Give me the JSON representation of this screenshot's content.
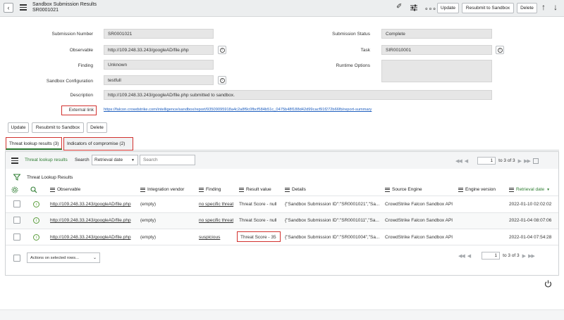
{
  "header": {
    "back_icon": "chevron-left-icon",
    "menu_icon": "hamburger-icon",
    "title": "Sandbox Submission Results",
    "record_id": "SR0001021",
    "attach_icon": "paperclip-icon",
    "settings_icon": "sliders-icon",
    "more_icon": "ellipsis-icon",
    "update_label": "Update",
    "resubmit_label": "Resubmit to Sandbox",
    "delete_label": "Delete",
    "up_icon": "arrow-up-icon",
    "down_icon": "arrow-down-icon"
  },
  "form": {
    "submission_number_label": "Submission Number",
    "submission_number": "SR0001021",
    "observable_label": "Observable",
    "observable": "http://109.248.33.243/googleAD/file.php",
    "finding_label": "Finding",
    "finding": "Unknown",
    "sandbox_config_label": "Sandbox Configuration",
    "sandbox_config": "testfull",
    "description_label": "Description",
    "description": "http://109.248.33.243/googleAD/file.php submitted to sandbox.",
    "external_link_label": "External link",
    "external_link": "https://falcon.crowdstrike.com/intelligence/sandbox/report/93509095918a4c2a8f9c0fbcf584b51c_0475b48f188d42d99cacf91f272b66fb/report-summary",
    "submission_status_label": "Submission Status",
    "submission_status": "Complete",
    "task_label": "Task",
    "task": "SIR0010001",
    "runtime_options_label": "Runtime Options",
    "runtime_options": ""
  },
  "actions": {
    "update_label": "Update",
    "resubmit_label": "Resubmit to Sandbox",
    "delete_label": "Delete"
  },
  "tabs": [
    {
      "label": "Threat lookup results (3)"
    },
    {
      "label": "Indicators of compromise (2)"
    }
  ],
  "list": {
    "title": "Threat lookup results",
    "search_label": "Search",
    "search_field": "Retrieval date",
    "search_placeholder": "Search",
    "breadcrumb": "Threat Lookup Results",
    "page_value": "1",
    "page_total": "to 3 of 3",
    "columns": [
      "Observable",
      "Integration vendor",
      "Finding",
      "Result value",
      "Details",
      "Source Engine",
      "Engine version",
      "Retrieval date"
    ],
    "rows": [
      {
        "observable": "http://109.248.33.243/googleAD/file.php",
        "vendor": "(empty)",
        "finding": "no specific threat",
        "result": "Threat Score - null",
        "details": "{\"Sandbox Submission ID\":\"SR0001021\",\"Sa...",
        "engine": "CrowdStrike Falcon Sandbox API",
        "version": "",
        "date": "2022-01-10 02:02:02"
      },
      {
        "observable": "http://109.248.33.243/googleAD/file.php",
        "vendor": "(empty)",
        "finding": "no specific threat",
        "result": "Threat Score - null",
        "details": "{\"Sandbox Submission ID\":\"SR0001011\",\"Sa...",
        "engine": "CrowdStrike Falcon Sandbox API",
        "version": "",
        "date": "2022-01-04 08:07:06"
      },
      {
        "observable": "http://109.248.33.243/googleAD/file.php",
        "vendor": "(empty)",
        "finding": "suspicious",
        "result": "Threat Score - 35",
        "details": "{\"Sandbox Submission ID\":\"SR0001004\",\"Sa...",
        "engine": "CrowdStrike Falcon Sandbox API",
        "version": "",
        "date": "2022-01-04 07:54:28"
      }
    ],
    "actions_select": "Actions on selected rows..."
  },
  "colors": {
    "accent": "#2e7d32",
    "highlight": "#d2312e",
    "header_bg": "#eceeef"
  }
}
